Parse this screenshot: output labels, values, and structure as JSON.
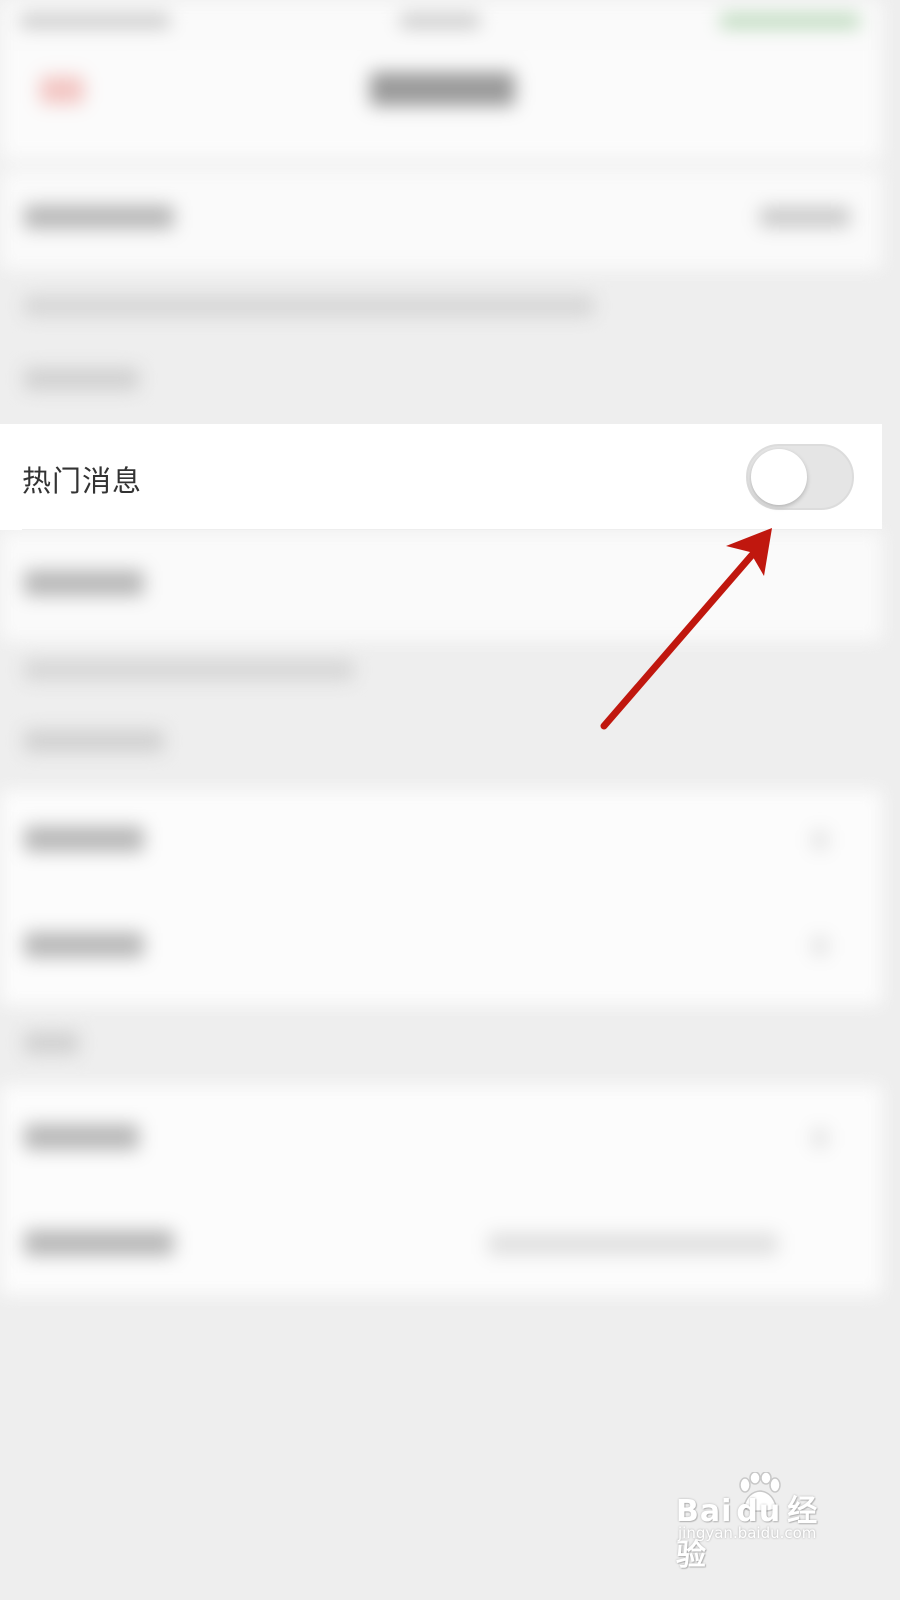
{
  "hot_messages_row": {
    "label": "热门消息",
    "toggle_state": "off",
    "toggle_track_color": "#e5e5e5",
    "toggle_knob_color": "#ffffff"
  },
  "annotation": {
    "arrow_color": "#c0170e",
    "arrow_target": "hot-messages-toggle"
  },
  "watermark": {
    "main_text": "Bai",
    "main_text_suffix": "经验",
    "paw_text": "du",
    "url": "jingyan.baidu.com"
  },
  "colors": {
    "background": "#eeeeee",
    "row_background": "#ffffff",
    "text": "#333333"
  }
}
